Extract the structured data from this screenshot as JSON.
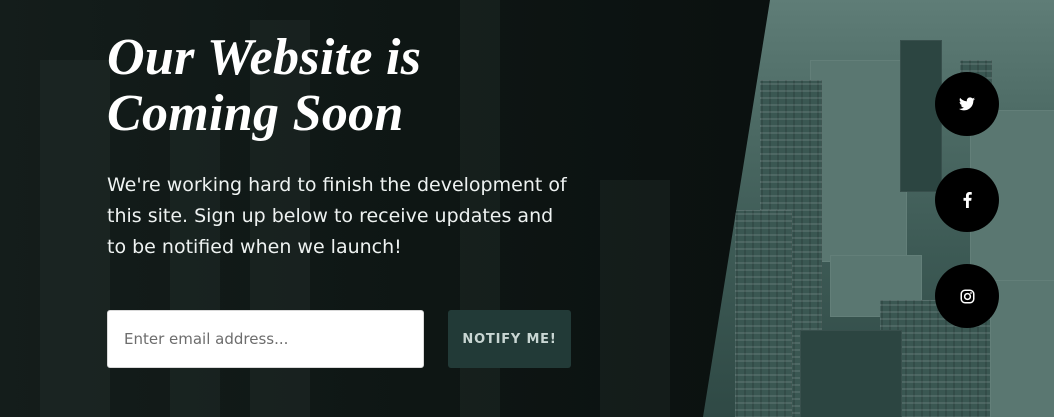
{
  "hero": {
    "title_line1": "Our Website is",
    "title_line2": "Coming Soon",
    "description": "We're working hard to finish the development of this site. Sign up below to receive updates and to be notified when we launch!"
  },
  "form": {
    "email_placeholder": "Enter email address...",
    "email_value": "",
    "notify_label": "NOTIFY ME!"
  },
  "social": [
    {
      "icon": "twitter-icon"
    },
    {
      "icon": "facebook-icon"
    },
    {
      "icon": "instagram-icon"
    }
  ],
  "colors": {
    "background": "#0b1412",
    "button_bg": "#223a37",
    "button_text": "#c9d6d3",
    "social_bg": "#000000"
  }
}
